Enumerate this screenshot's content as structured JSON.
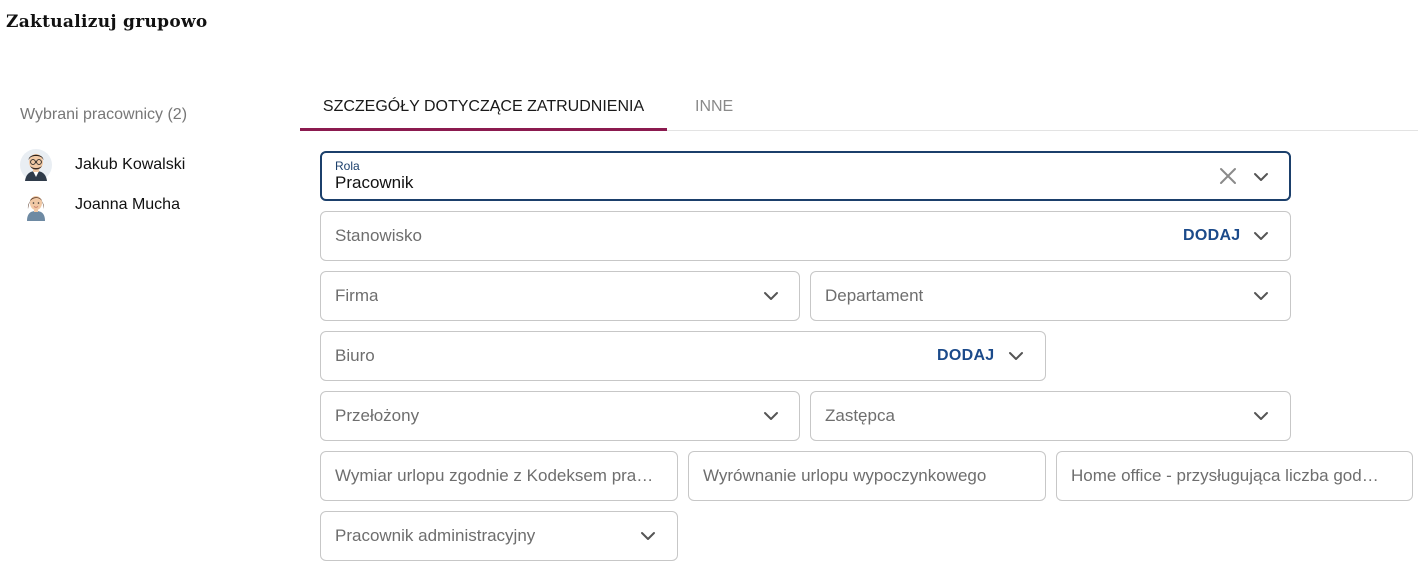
{
  "page": {
    "title": "Zaktualizuj grupowo"
  },
  "selected": {
    "header": "Wybrani pracownicy (2)",
    "employees": [
      {
        "name": "Jakub Kowalski",
        "avatar": "male-avatar-icon"
      },
      {
        "name": "Joanna Mucha",
        "avatar": "female-avatar-icon"
      }
    ]
  },
  "tabs": [
    {
      "label": "SZCZEGÓŁY DOTYCZĄCE ZATRUDNIENIA",
      "active": true
    },
    {
      "label": "INNE",
      "active": false
    }
  ],
  "form": {
    "rola": {
      "label": "Rola",
      "value": "Pracownik"
    },
    "stanowisko": {
      "placeholder": "Stanowisko",
      "action": "DODAJ"
    },
    "firma": {
      "placeholder": "Firma"
    },
    "departament": {
      "placeholder": "Departament"
    },
    "biuro": {
      "placeholder": "Biuro",
      "action": "DODAJ"
    },
    "przelozony": {
      "placeholder": "Przełożony"
    },
    "zastepca": {
      "placeholder": "Zastępca"
    },
    "wymiar_urlopu": {
      "placeholder": "Wymiar urlopu zgodnie z Kodeksem pra…"
    },
    "wyrownanie_urlopu": {
      "placeholder": "Wyrównanie urlopu wypoczynkowego"
    },
    "home_office": {
      "placeholder": "Home office - przysługująca liczba god…"
    },
    "pracownik_administracyjny": {
      "placeholder": "Pracownik administracyjny"
    }
  },
  "colors": {
    "accent_tab": "#8b1a4f",
    "focus_border": "#1b3f6b",
    "action_link": "#1b4a8a"
  }
}
